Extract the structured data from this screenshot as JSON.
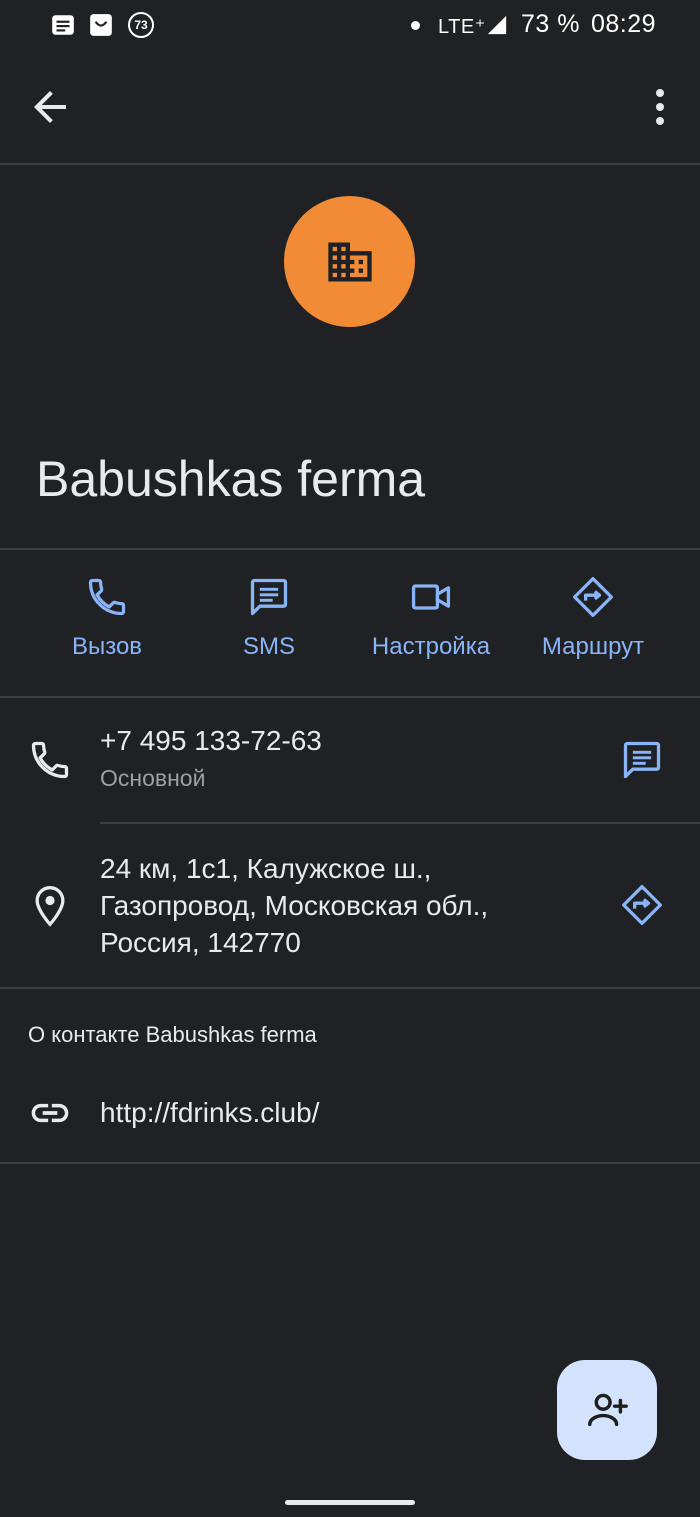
{
  "status_bar": {
    "notification_count": "73",
    "network": "LTE⁺",
    "battery": "73 %",
    "time": "08:29"
  },
  "contact": {
    "name": "Babushkas ferma"
  },
  "actions": [
    {
      "label": "Вызов",
      "icon": "phone-icon"
    },
    {
      "label": "SMS",
      "icon": "message-icon"
    },
    {
      "label": "Настройка",
      "icon": "video-icon"
    },
    {
      "label": "Маршрут",
      "icon": "directions-icon"
    }
  ],
  "phone": {
    "number": "+7 495 133-72-63",
    "type": "Основной"
  },
  "address": {
    "lines": [
      "24 км, 1с1, Калужское ш.,",
      "Газопровод, Московская обл.,",
      "Россия, 142770"
    ]
  },
  "about": {
    "title": "О контакте Babushkas ferma",
    "website": "http://fdrinks.club/"
  },
  "colors": {
    "background": "#202124",
    "accent": "#8ab4f8",
    "avatar": "#f28b36",
    "fab": "#d3e3fd"
  }
}
